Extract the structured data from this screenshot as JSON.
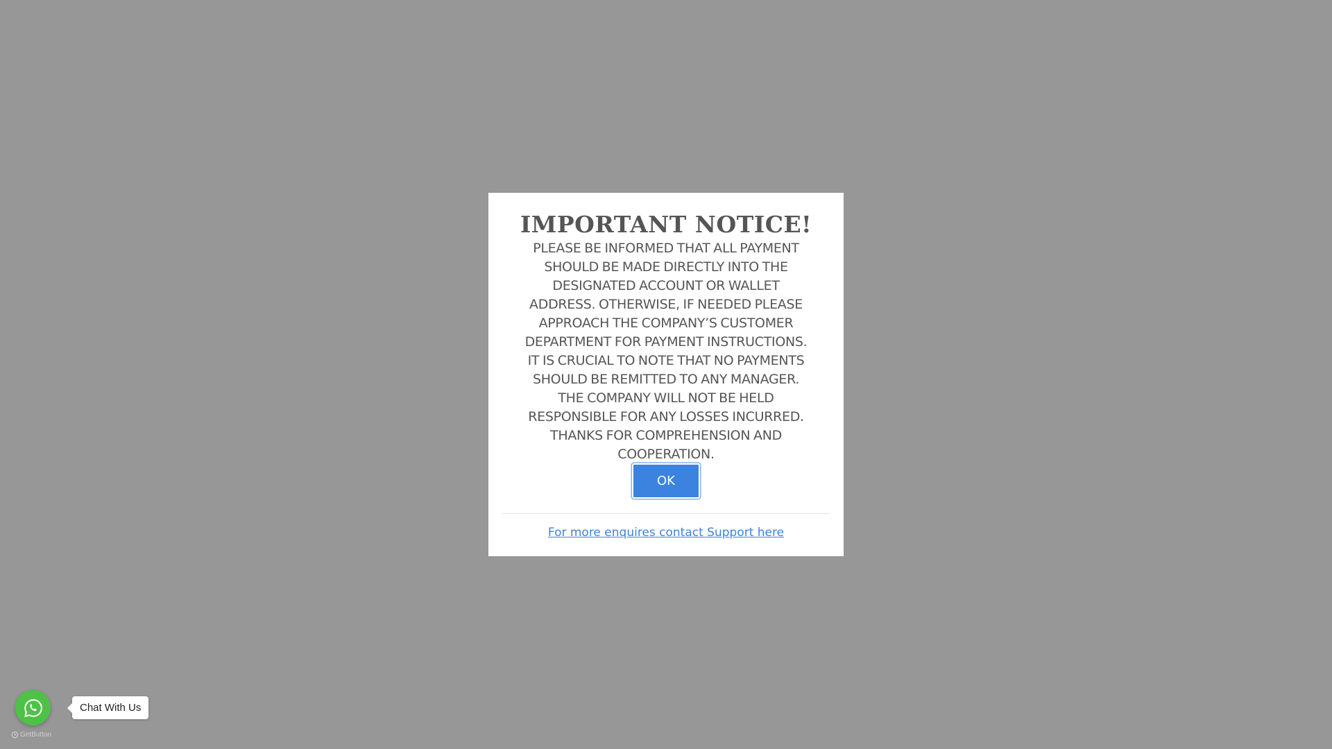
{
  "modal": {
    "title": "IMPORTANT NOTICE!",
    "body": "Please be informed that all payment should be made directly into the designated account or wallet address. Otherwise, if needed please approach the company’s customer department for payment instructions. It is crucial to note that no payments should be remitted to any manager. The company will not be held responsible for any losses incurred. Thanks for comprehension and cooperation.",
    "ok_label": "OK",
    "support_link": "For more enquires contact Support here"
  },
  "chat_widget": {
    "label": "Chat With Us",
    "icon": "whatsapp-icon",
    "brand_color": "#4dc247",
    "powered_by": "GetButton"
  },
  "colors": {
    "overlay": "#979797",
    "accent": "#3b83de",
    "text": "#555555"
  }
}
